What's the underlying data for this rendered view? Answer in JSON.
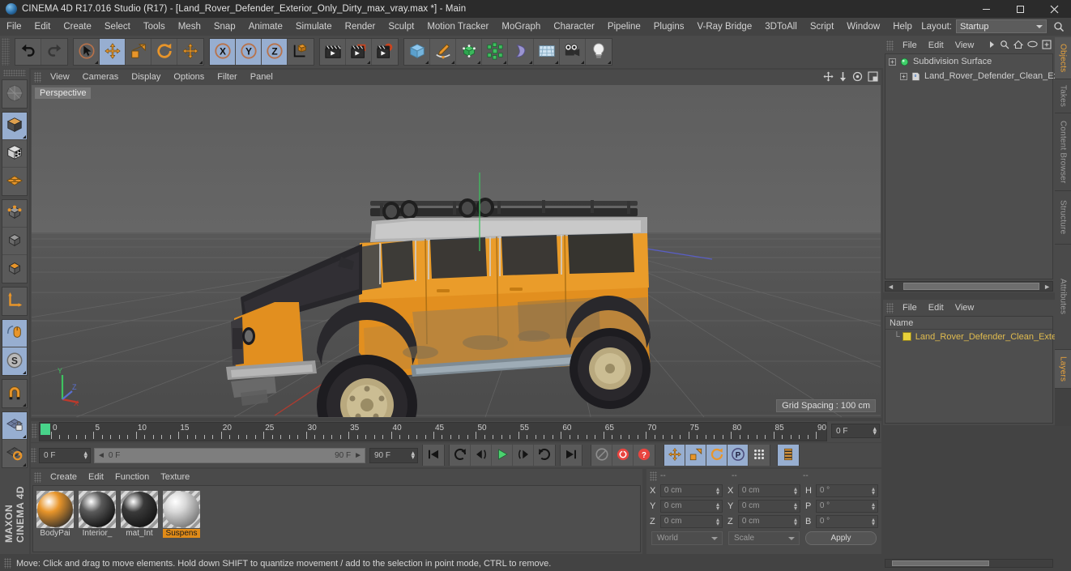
{
  "window": {
    "title": "CINEMA 4D R17.016 Studio (R17) - [Land_Rover_Defender_Exterior_Only_Dirty_max_vray.max *] - Main",
    "minimize": "minimize-icon",
    "maximize": "maximize-icon",
    "close": "close-icon"
  },
  "menu": {
    "items": [
      "File",
      "Edit",
      "Create",
      "Select",
      "Tools",
      "Mesh",
      "Snap",
      "Animate",
      "Simulate",
      "Render",
      "Sculpt",
      "Motion Tracker",
      "MoGraph",
      "Character",
      "Pipeline",
      "Plugins",
      "V-Ray Bridge",
      "3DToAll",
      "Script",
      "Window",
      "Help"
    ],
    "layout_label": "Layout:",
    "layout_value": "Startup"
  },
  "toolbar": {
    "groups": [
      {
        "name": "undo-redo",
        "buttons": [
          {
            "name": "undo-button",
            "icon": "undo-arrow-icon",
            "selected": false,
            "dim": false
          },
          {
            "name": "redo-button",
            "icon": "redo-arrow-icon",
            "selected": false,
            "dim": true
          }
        ]
      },
      {
        "name": "transform-tools",
        "buttons": [
          {
            "name": "live-selection-tool",
            "icon": "cursor-circle-icon",
            "selected": false,
            "dim": false,
            "corner": true
          },
          {
            "name": "move-tool",
            "icon": "move-arrows-icon",
            "selected": true,
            "dim": false
          },
          {
            "name": "scale-tool",
            "icon": "scale-box-icon",
            "selected": false,
            "dim": false
          },
          {
            "name": "rotate-tool",
            "icon": "rotate-circle-icon",
            "selected": false,
            "dim": false
          },
          {
            "name": "magnet-move-tool",
            "icon": "move-arrows-icon",
            "selected": false,
            "dim": false,
            "corner": true
          }
        ]
      },
      {
        "name": "axis-locks",
        "buttons": [
          {
            "name": "lock-x-axis",
            "icon": "x-axis-icon",
            "label": "X",
            "selected": true
          },
          {
            "name": "lock-y-axis",
            "icon": "y-axis-icon",
            "label": "Y",
            "selected": true
          },
          {
            "name": "lock-z-axis",
            "icon": "z-axis-icon",
            "label": "Z",
            "selected": true
          },
          {
            "name": "world-object-coordinate-toggle",
            "icon": "world-axis-cube-icon",
            "selected": false
          }
        ]
      },
      {
        "name": "render-group",
        "buttons": [
          {
            "name": "render-view-button",
            "icon": "clapboard-icon",
            "selected": false
          },
          {
            "name": "render-to-picture-viewer-button",
            "icon": "clapboard-red-icon",
            "selected": false,
            "corner": true
          },
          {
            "name": "edit-render-settings-button",
            "icon": "clapboard-gear-icon",
            "selected": false
          }
        ]
      },
      {
        "name": "create-objects",
        "buttons": [
          {
            "name": "add-cube-button",
            "icon": "blue-cube-icon",
            "selected": false,
            "corner": true
          },
          {
            "name": "add-spline-button",
            "icon": "pen-spline-icon",
            "selected": false,
            "corner": true
          },
          {
            "name": "add-nurbs-button",
            "icon": "green-nurbs-icon",
            "selected": false,
            "corner": true
          },
          {
            "name": "add-array-button",
            "icon": "green-array-icon",
            "selected": false,
            "corner": true
          },
          {
            "name": "add-deformer-button",
            "icon": "bend-deformer-icon",
            "selected": false,
            "corner": true
          },
          {
            "name": "add-floor-button",
            "icon": "environment-grid-icon",
            "selected": false,
            "corner": true
          },
          {
            "name": "add-camera-button",
            "icon": "camera-icon",
            "selected": false,
            "corner": true
          },
          {
            "name": "add-light-button",
            "icon": "light-bulb-icon",
            "selected": false,
            "corner": true
          }
        ]
      }
    ]
  },
  "left_palette": {
    "groups": [
      {
        "name": "group-viewmode",
        "buttons": [
          {
            "name": "make-editable-button",
            "icon": "make-editable-icon",
            "selected": false
          }
        ]
      },
      {
        "name": "group-modes",
        "buttons": [
          {
            "name": "model-mode-button",
            "icon": "model-cube-icon",
            "selected": true,
            "corner": true
          },
          {
            "name": "texture-mode-button",
            "icon": "texture-cube-icon",
            "selected": false
          },
          {
            "name": "workplane-mode-button",
            "icon": "workplane-grid-icon",
            "selected": false
          }
        ]
      },
      {
        "name": "group-components",
        "buttons": [
          {
            "name": "points-mode-button",
            "icon": "points-cube-icon",
            "selected": false
          },
          {
            "name": "edges-mode-button",
            "icon": "edges-cube-icon",
            "selected": false
          },
          {
            "name": "polygons-mode-button",
            "icon": "polygons-cube-icon",
            "selected": false
          }
        ]
      },
      {
        "name": "group-axis",
        "buttons": [
          {
            "name": "enable-axis-modification-button",
            "icon": "axis-L-icon",
            "selected": false
          }
        ]
      },
      {
        "name": "group-snapping",
        "buttons": [
          {
            "name": "viewport-solo-button",
            "icon": "mouse-orange-icon",
            "selected": true
          },
          {
            "name": "enable-snap-button",
            "icon": "snap-S-icon",
            "selected": true,
            "corner": true
          }
        ]
      },
      {
        "name": "group-magnet",
        "buttons": [
          {
            "name": "magnet-tool-button",
            "icon": "magnet-icon",
            "selected": false,
            "corner": true
          }
        ]
      },
      {
        "name": "group-lock",
        "buttons": [
          {
            "name": "lock-workplane-button",
            "icon": "workplane-lock-icon",
            "selected": true,
            "corner": true
          },
          {
            "name": "planar-workplane-button",
            "icon": "workplane-rotate-icon",
            "selected": false,
            "corner": true
          }
        ]
      }
    ],
    "brand_line1": "MAXON",
    "brand_line2": "CINEMA 4D"
  },
  "viewport": {
    "menu_items": [
      "View",
      "Cameras",
      "Display",
      "Options",
      "Filter",
      "Panel"
    ],
    "view_label": "Perspective",
    "grid_spacing": "Grid Spacing : 100 cm",
    "corner_icons": [
      "pan-view-icon",
      "move-camera-icon",
      "rotate-view-icon",
      "maximize-view-icon"
    ],
    "axis_labels": {
      "x": "X",
      "y": "Y",
      "z": "Z"
    }
  },
  "object_manager": {
    "menu_items": [
      "File",
      "Edit",
      "View"
    ],
    "header_icons": [
      "more-arrow-icon",
      "search-icon",
      "home-icon",
      "eye-icon",
      "new-layer-icon"
    ],
    "tree": [
      {
        "name": "subdivision-surface-object",
        "label": "Subdivision Surface",
        "icon": "generator-green-icon",
        "depth": 0
      },
      {
        "name": "mesh-object",
        "label": "Land_Rover_Defender_Clean_Ext",
        "icon": "polygon-object-icon",
        "depth": 1
      }
    ]
  },
  "layer_manager": {
    "menu_items": [
      "File",
      "Edit",
      "View"
    ],
    "column_header": "Name",
    "rows": [
      {
        "name": "layer-row",
        "label": "Land_Rover_Defender_Clean_Exte",
        "color": "#e8d13a"
      }
    ]
  },
  "vertical_tabs": [
    {
      "name": "tab-objects",
      "label": "Objects",
      "active": true
    },
    {
      "name": "tab-takes",
      "label": "Takes",
      "active": false
    },
    {
      "name": "tab-content-browser",
      "label": "Content Browser",
      "active": false
    },
    {
      "name": "tab-structure",
      "label": "Structure",
      "active": false
    },
    {
      "name": "tab-attributes",
      "label": "Attributes",
      "active": false
    },
    {
      "name": "tab-layers",
      "label": "Layers",
      "active": true
    }
  ],
  "timeline": {
    "tick_labels": [
      "0",
      "5",
      "10",
      "15",
      "20",
      "25",
      "30",
      "35",
      "40",
      "45",
      "50",
      "55",
      "60",
      "65",
      "70",
      "75",
      "80",
      "85",
      "90"
    ],
    "tick_values": [
      0,
      5,
      10,
      15,
      20,
      25,
      30,
      35,
      40,
      45,
      50,
      55,
      60,
      65,
      70,
      75,
      80,
      85,
      90
    ],
    "range_min": 0,
    "range_max": 90,
    "current_frame_field": "0 F"
  },
  "transport": {
    "current_frame": "0 F",
    "range_start": "0 F",
    "range_end": "90 F",
    "max_frame": "90 F",
    "buttons": [
      {
        "name": "go-to-start-button",
        "icon": "skip-start-icon",
        "selected": false
      },
      {
        "name": "play-backwards-loop-button",
        "icon": "loop-back-icon",
        "selected": false
      },
      {
        "name": "step-back-button",
        "icon": "step-back-icon",
        "selected": false
      },
      {
        "name": "play-button",
        "icon": "play-icon",
        "selected": false
      },
      {
        "name": "step-forward-button",
        "icon": "step-forward-icon",
        "selected": false
      },
      {
        "name": "play-forward-loop-button",
        "icon": "loop-forward-icon",
        "selected": false
      },
      {
        "name": "go-to-end-button",
        "icon": "skip-end-icon",
        "selected": false
      },
      {
        "name": "autokeying-button",
        "icon": "record-disabled-icon",
        "selected": false
      },
      {
        "name": "record-active-objects-button",
        "icon": "record-red-icon",
        "selected": false
      },
      {
        "name": "autokeying-toggle-button",
        "icon": "record-question-icon",
        "selected": false
      },
      {
        "name": "key-position-button",
        "icon": "key-position-icon",
        "selected": true
      },
      {
        "name": "key-scale-button",
        "icon": "key-scale-icon",
        "selected": true
      },
      {
        "name": "key-rotation-button",
        "icon": "key-rotation-icon",
        "selected": true
      },
      {
        "name": "key-parameter-button",
        "icon": "key-parameter-icon",
        "selected": true
      },
      {
        "name": "key-point-level-animation-button",
        "icon": "key-pla-icon",
        "selected": false
      },
      {
        "name": "timeline-layout-button",
        "icon": "timeline-stripes-icon",
        "selected": true
      }
    ]
  },
  "material_manager": {
    "menu_items": [
      "Create",
      "Edit",
      "Function",
      "Texture"
    ],
    "materials": [
      {
        "name": "material-bodypaint",
        "label": "BodyPai",
        "selected": false,
        "color1": "#e8952a",
        "color2": "#2a2a2a"
      },
      {
        "name": "material-interior",
        "label": "Interior_",
        "selected": false,
        "color1": "#5a5a5a",
        "color2": "#0a0a0a"
      },
      {
        "name": "material-mat-int",
        "label": "mat_Int",
        "selected": false,
        "color1": "#3a3a3a",
        "color2": "#101010"
      },
      {
        "name": "material-suspension",
        "label": "Suspens",
        "selected": true,
        "color1": "#d8d8d8",
        "color2": "#6e6e6e"
      }
    ]
  },
  "coordinates": {
    "header_cols": [
      "--",
      "--",
      "--"
    ],
    "rows": [
      {
        "name": "coord-row-x",
        "pos_label": "X",
        "pos_value": "0 cm",
        "size_label": "X",
        "size_value": "0 cm",
        "rot_label": "H",
        "rot_value": "0 °"
      },
      {
        "name": "coord-row-y",
        "pos_label": "Y",
        "pos_value": "0 cm",
        "size_label": "Y",
        "size_value": "0 cm",
        "rot_label": "P",
        "rot_value": "0 °"
      },
      {
        "name": "coord-row-z",
        "pos_label": "Z",
        "pos_value": "0 cm",
        "size_label": "Z",
        "size_value": "0 cm",
        "rot_label": "B",
        "rot_value": "0 °"
      }
    ],
    "coord_system": "World",
    "size_mode": "Scale",
    "apply_label": "Apply"
  },
  "statusbar": {
    "message": "Move: Click and drag to move elements. Hold down SHIFT to quantize movement / add to the selection in point mode, CTRL to remove."
  },
  "colors": {
    "accent_orange": "#e8952a",
    "selected_blue": "#97aed0",
    "bg_chrome": "#4a4a4a",
    "titlebar": "#2b2b2b",
    "playhead_green": "#48d48a",
    "layer_yellow": "#e8d13a"
  }
}
